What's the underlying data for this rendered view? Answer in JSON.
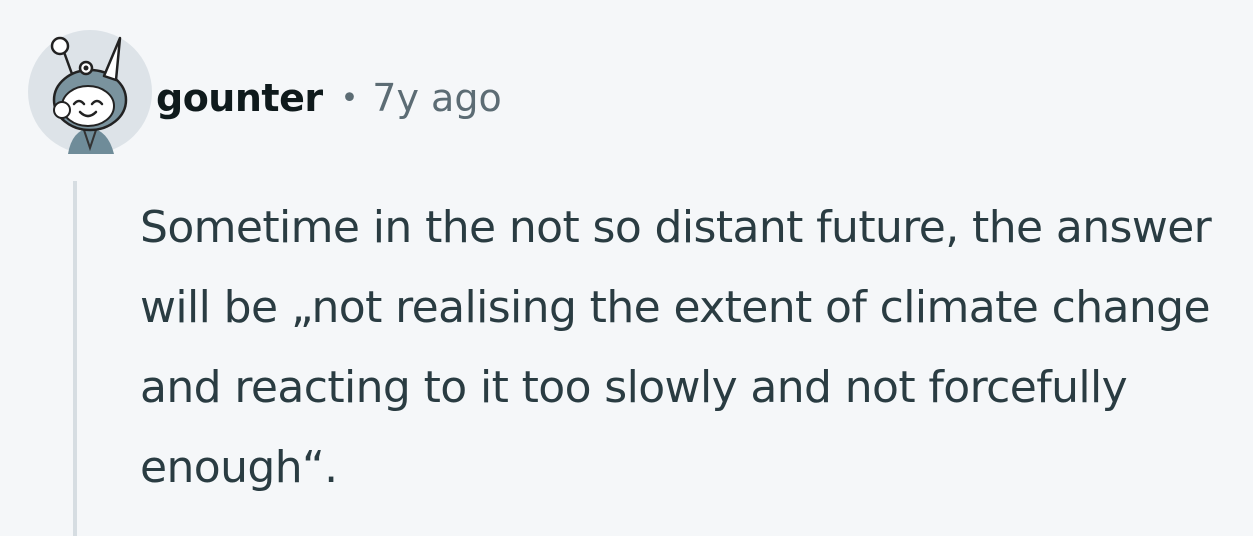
{
  "comment": {
    "username": "gounter",
    "separator": "•",
    "age": "7y ago",
    "body": "Sometime in the not so distant future, the answer will be „not realising the extent of climate change and reacting to it too slowly and not forcefully enough“."
  },
  "avatar": {
    "icon": "snoo-avatar-icon",
    "background_color": "#dde3e8"
  },
  "colors": {
    "page_background": "#f5f7f9",
    "username": "#0f1a1c",
    "meta": "#5c6c74",
    "body_text": "#2a3c42",
    "thread_line": "#d6dde2"
  }
}
